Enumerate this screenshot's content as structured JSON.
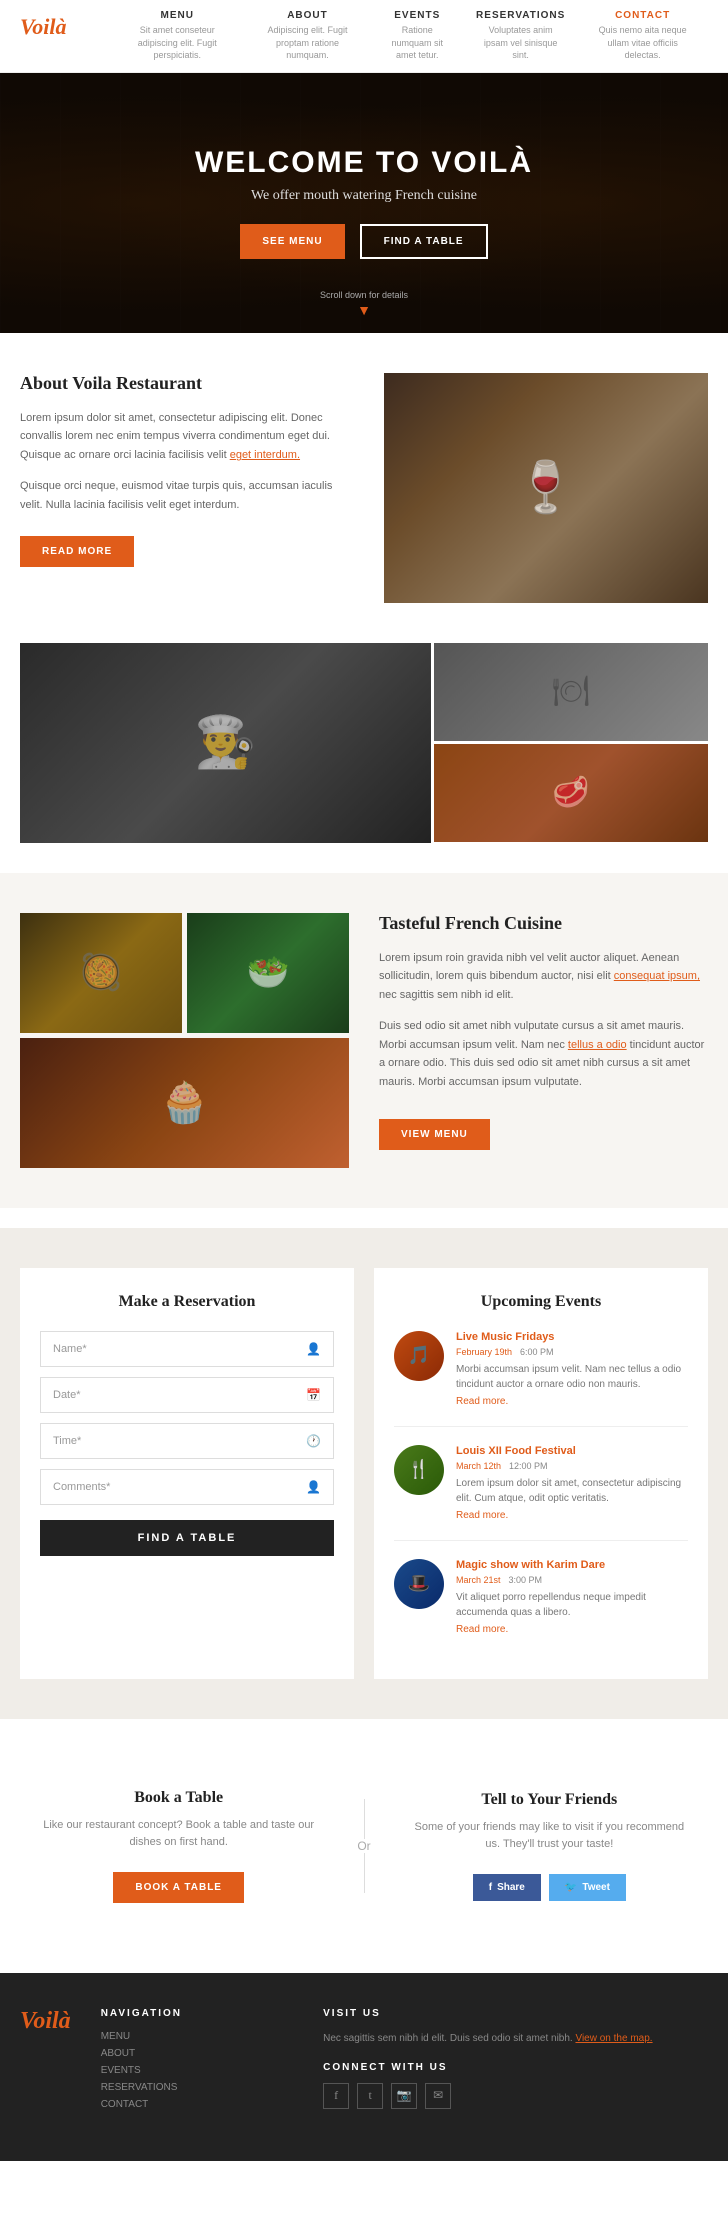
{
  "nav": {
    "logo": "Voilà",
    "items": [
      {
        "label": "MENU",
        "desc": "Sit amet conseteur adipiscing elit. Fugit perspiciatis.",
        "active": false
      },
      {
        "label": "ABOUT",
        "desc": "Adipiscing elit. Fugit proptam ratione numquam.",
        "active": false
      },
      {
        "label": "EVENTS",
        "desc": "Ratione numquam sit amet tetur.",
        "active": false
      },
      {
        "label": "RESERVATIONS",
        "desc": "Voluptates anim ipsam vel sinisque sint.",
        "active": false
      },
      {
        "label": "CONTACT",
        "desc": "Quis nemo aita neque ullam vitae officiis delectas.",
        "active": true
      }
    ]
  },
  "hero": {
    "title": "WELCOME TO VOILÀ",
    "subtitle": "We offer mouth watering French cuisine",
    "btn_menu": "SEE MENU",
    "btn_table": "FIND A TABLE",
    "scroll_text": "Scroll down for details"
  },
  "about": {
    "title": "About Voila Restaurant",
    "p1": "Lorem ipsum dolor sit amet, consectetur adipiscing elit. Donec convallis lorem nec enim tempus viverra condimentum eget dui. Quisque ac ornare orci lacinia facilisis velit ",
    "p1_link": "eget interdum.",
    "p2": "Quisque orci neque, euismod vitae turpis quis, accumsan iaculis velit. Nulla lacinia facilisis velit eget interdum.",
    "btn_read": "READ MORE"
  },
  "cuisine": {
    "title": "Tasteful French Cuisine",
    "p1": "Lorem ipsum roin gravida nibh vel velit auctor aliquet. Aenean sollicitudin, lorem quis bibendum auctor, nisi elit ",
    "p1_link": "consequat ipsum,",
    "p1b": " nec sagittis sem nibh id elit.",
    "p2": "Duis sed odio sit amet nibh vulputate cursus a sit amet mauris. Morbi accumsan ipsum velit. Nam nec ",
    "p2_link": "tellus a odio",
    "p2b": " tincidunt auctor a ornare odio. This duis sed odio sit amet nibh cursus a sit amet mauris. Morbi accumsan ipsum vulputate.",
    "btn_menu": "VIEW MENU"
  },
  "reservation": {
    "title": "Make a Reservation",
    "name_placeholder": "Name*",
    "date_placeholder": "Date*",
    "time_placeholder": "Time*",
    "comments_placeholder": "Comments*",
    "btn_find": "FIND A TABLE"
  },
  "events": {
    "title": "Upcoming Events",
    "items": [
      {
        "title": "Live Music Fridays",
        "date": "February 19th",
        "time": "6:00 PM",
        "desc": "Morbi accumsan ipsum velit. Nam nec tellus a odio tincidunt auctor a ornare odio non mauris.",
        "read_more": "Read more.",
        "icon": "🎵"
      },
      {
        "title": "Louis XII Food Festival",
        "date": "March 12th",
        "time": "12:00 PM",
        "desc": "Lorem ipsum dolor sit amet, consectetur adipiscing elit. Cum atque, odit optic veritatis.",
        "read_more": "Read more.",
        "icon": "🍴"
      },
      {
        "title": "Magic show with Karim Dare",
        "date": "March 21st",
        "time": "3:00 PM",
        "desc": "Vit aliquet porro repellendus neque impedit accumenda quas a libero.",
        "read_more": "Read more.",
        "icon": "🎩"
      }
    ]
  },
  "book": {
    "title": "Book a Table",
    "desc": "Like our restaurant concept? Book a table and taste our dishes on first hand.",
    "btn": "BOOK A TABLE",
    "or": "Or"
  },
  "share": {
    "title": "Tell to Your Friends",
    "desc": "Some of your friends may like to visit if you recommend us. They'll trust your taste!",
    "btn_fb": "Share",
    "btn_tw": "Tweet"
  },
  "footer": {
    "logo": "Voilà",
    "nav_title": "NAVIGATION",
    "nav_items": [
      "MENU",
      "ABOUT",
      "EVENTS",
      "RESERVATIONS",
      "CONTACT"
    ],
    "visit_title": "VISIT US",
    "visit_text": "Nec sagittis sem nibh id elit. Duis sed odio sit amet nibh. ",
    "visit_link": "View on the map.",
    "connect_title": "CONNECT WITH US",
    "social_icons": [
      "f",
      "t",
      "📷",
      "✉"
    ]
  }
}
